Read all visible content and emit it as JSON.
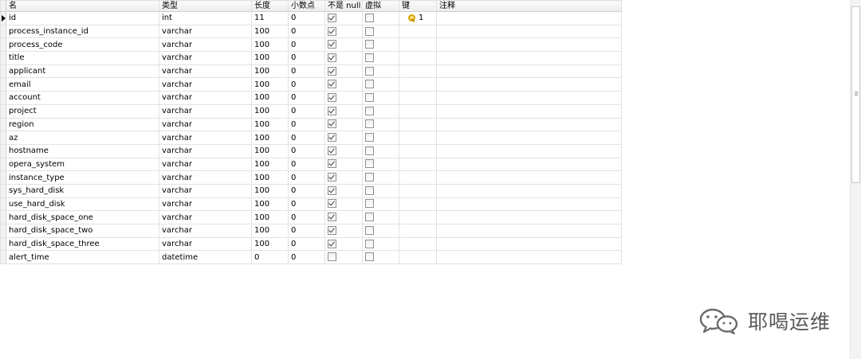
{
  "columns": [
    "名",
    "类型",
    "长度",
    "小数点",
    "不是 null",
    "虚拟",
    "键",
    "注释"
  ],
  "rows": [
    {
      "name": "id",
      "type": "int",
      "length": "11",
      "decimal": "0",
      "not_null": true,
      "virtual": false,
      "key": "1",
      "comment": ""
    },
    {
      "name": "process_instance_id",
      "type": "varchar",
      "length": "100",
      "decimal": "0",
      "not_null": true,
      "virtual": false,
      "key": "",
      "comment": ""
    },
    {
      "name": "process_code",
      "type": "varchar",
      "length": "100",
      "decimal": "0",
      "not_null": true,
      "virtual": false,
      "key": "",
      "comment": ""
    },
    {
      "name": "title",
      "type": "varchar",
      "length": "100",
      "decimal": "0",
      "not_null": true,
      "virtual": false,
      "key": "",
      "comment": ""
    },
    {
      "name": "applicant",
      "type": "varchar",
      "length": "100",
      "decimal": "0",
      "not_null": true,
      "virtual": false,
      "key": "",
      "comment": ""
    },
    {
      "name": "email",
      "type": "varchar",
      "length": "100",
      "decimal": "0",
      "not_null": true,
      "virtual": false,
      "key": "",
      "comment": ""
    },
    {
      "name": "account",
      "type": "varchar",
      "length": "100",
      "decimal": "0",
      "not_null": true,
      "virtual": false,
      "key": "",
      "comment": ""
    },
    {
      "name": "project",
      "type": "varchar",
      "length": "100",
      "decimal": "0",
      "not_null": true,
      "virtual": false,
      "key": "",
      "comment": ""
    },
    {
      "name": "region",
      "type": "varchar",
      "length": "100",
      "decimal": "0",
      "not_null": true,
      "virtual": false,
      "key": "",
      "comment": ""
    },
    {
      "name": "az",
      "type": "varchar",
      "length": "100",
      "decimal": "0",
      "not_null": true,
      "virtual": false,
      "key": "",
      "comment": ""
    },
    {
      "name": "hostname",
      "type": "varchar",
      "length": "100",
      "decimal": "0",
      "not_null": true,
      "virtual": false,
      "key": "",
      "comment": ""
    },
    {
      "name": "opera_system",
      "type": "varchar",
      "length": "100",
      "decimal": "0",
      "not_null": true,
      "virtual": false,
      "key": "",
      "comment": ""
    },
    {
      "name": "instance_type",
      "type": "varchar",
      "length": "100",
      "decimal": "0",
      "not_null": true,
      "virtual": false,
      "key": "",
      "comment": ""
    },
    {
      "name": "sys_hard_disk",
      "type": "varchar",
      "length": "100",
      "decimal": "0",
      "not_null": true,
      "virtual": false,
      "key": "",
      "comment": ""
    },
    {
      "name": "use_hard_disk",
      "type": "varchar",
      "length": "100",
      "decimal": "0",
      "not_null": true,
      "virtual": false,
      "key": "",
      "comment": ""
    },
    {
      "name": "hard_disk_space_one",
      "type": "varchar",
      "length": "100",
      "decimal": "0",
      "not_null": true,
      "virtual": false,
      "key": "",
      "comment": ""
    },
    {
      "name": "hard_disk_space_two",
      "type": "varchar",
      "length": "100",
      "decimal": "0",
      "not_null": true,
      "virtual": false,
      "key": "",
      "comment": ""
    },
    {
      "name": "hard_disk_space_three",
      "type": "varchar",
      "length": "100",
      "decimal": "0",
      "not_null": true,
      "virtual": false,
      "key": "",
      "comment": ""
    },
    {
      "name": "alert_time",
      "type": "datetime",
      "length": "0",
      "decimal": "0",
      "not_null": false,
      "virtual": false,
      "key": "",
      "comment": ""
    }
  ],
  "watermark": {
    "text": "耶喝运维",
    "icon": "wechat-icon"
  },
  "colors": {
    "grid_line": "#e2e2e2",
    "key_gold": "#d9a400"
  }
}
